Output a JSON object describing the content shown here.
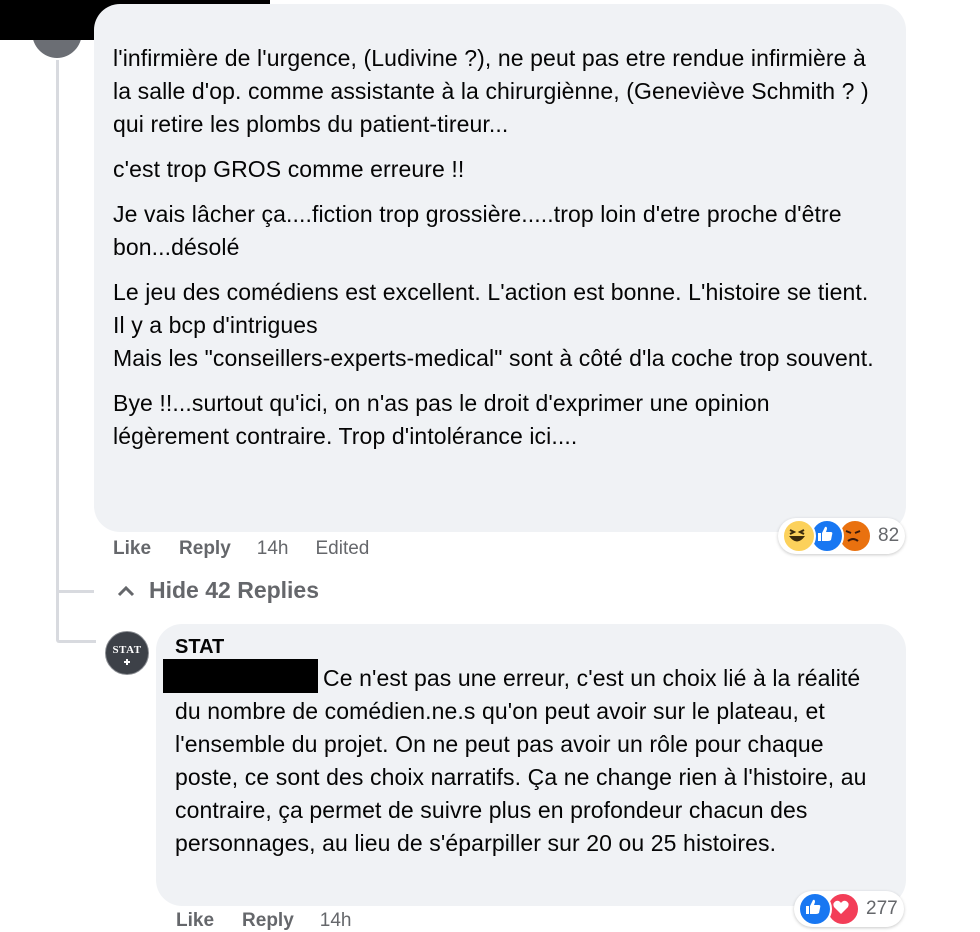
{
  "comment1": {
    "paragraphs": [
      "l'infirmière de l'urgence, (Ludivine ?), ne peut pas etre rendue infirmière à la salle d'op. comme assistante à la chirurgiènne, (Geneviève Schmith ? )\nqui retire les plombs du patient-tireur...",
      "c'est trop GROS comme erreure !!",
      "Je vais lâcher ça....fiction trop grossière.....trop loin d'etre proche d'être bon...désolé",
      "Le jeu des comédiens est excellent. L'action est bonne. L'histoire se tient. Il y a bcp d'intrigues\nMais les \"conseillers-experts-medical\" sont à côté d'la coche trop souvent.",
      "Bye !!...surtout qu'ici, on n'as pas le droit d'exprimer une opinion légèrement contraire. Trop d'intolérance ici...."
    ],
    "actions": {
      "like": "Like",
      "reply": "Reply",
      "time": "14h",
      "edited": "Edited"
    },
    "reactions": {
      "count": "82",
      "icons": [
        "haha-icon",
        "like-icon",
        "angry-icon"
      ]
    }
  },
  "hide_replies": {
    "label": "Hide 42 Replies"
  },
  "reply1": {
    "author": "STAT",
    "avatar_text": "STAT",
    "text": "Ce n'est pas une erreur, c'est un choix lié à la réalité du nombre de comédien.ne.s qu'on peut avoir sur le plateau, et l'ensemble du projet. On ne peut pas avoir un rôle pour chaque poste, ce sont des choix narratifs. Ça ne change rien à l'histoire, au contraire, ça permet de suivre plus en profondeur chacun des personnages, au lieu de s'éparpiller sur 20 ou 25 histoires.",
    "actions": {
      "like": "Like",
      "reply": "Reply",
      "time": "14h"
    },
    "reactions": {
      "count": "277",
      "icons": [
        "like-icon",
        "love-icon"
      ]
    }
  },
  "colors": {
    "bubble": "#f0f2f5",
    "meta_text": "#65676b",
    "like_blue": "#1877f2",
    "love_red": "#f33e58",
    "haha_yellow": "#fcd15b",
    "angry_orange": "#e9710f"
  }
}
